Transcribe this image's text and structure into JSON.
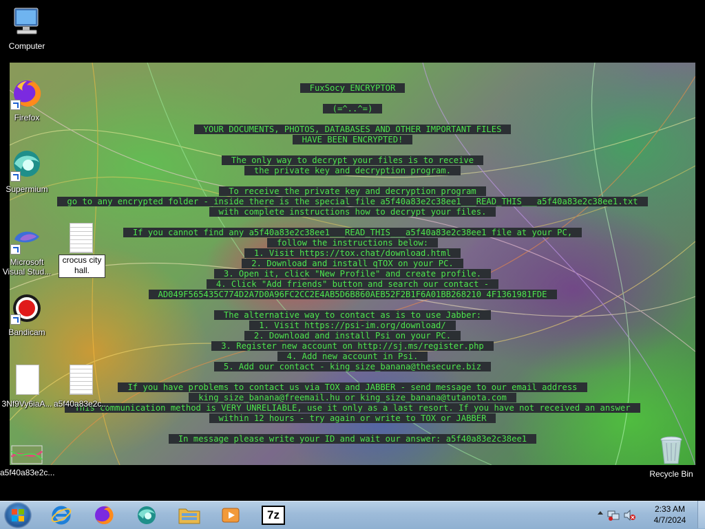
{
  "desktop_icons": {
    "computer": "Computer",
    "firefox": "Firefox",
    "supermium": "Supermium",
    "vs_line1": "Microsoft",
    "vs_line2": "Visual Stud...",
    "bandicam": "Bandicam",
    "file_3nf": "3Nf9Vy6iaA...",
    "file_a5f_txt": "a5f40a83e2c...",
    "file_a5f_img": "a5f40a83e2c...",
    "recycle_bin": "Recycle Bin",
    "rename_line1": "crocus city",
    "rename_line2": "hall."
  },
  "ransom_note": {
    "lines": [
      "FuxSocy ENCRYPTOR",
      "",
      "(=^..^=)",
      "",
      "YOUR DOCUMENTS, PHOTOS, DATABASES AND OTHER IMPORTANT FILES",
      "HAVE BEEN ENCRYPTED!",
      "",
      "The only way to decrypt your files is to receive",
      "the private key and decryption program.",
      "",
      "To receive the private key and decryption program",
      "go to any encrypted folder - inside there is the special file a5f40a83e2c38ee1___READ_THIS___a5f40a83e2c38ee1.txt",
      "with complete instructions how to decrypt your files.",
      "",
      "If you cannot find any a5f40a83e2c38ee1___READ_THIS___a5f40a83e2c38ee1 file at your PC,",
      "follow the instructions below:",
      "1. Visit https://tox.chat/download.html",
      "2. Download and install qTOX on your PC.",
      "3. Open it, click \"New Profile\" and create profile.",
      "4. Click \"Add friends\" button and search our contact -",
      "AD049F565435C774D2A7D0A96FC2CC2E4AB5D6B860AEB52F2B1F6A01BB268210 4F1361981FDE",
      "",
      "The alternative way to contact as is to use Jabber:",
      "1. Visit https://psi-im.org/download/",
      "2. Download and install Psi on your PC.",
      "3. Register new account on http://sj.ms/register.php",
      "4. Add new account in Psi.",
      "5. Add our contact - king_size_banana@thesecure.biz",
      "",
      "If you have problems to contact us via TOX and JABBER - send message to our email address",
      "king_size_banana@freemail.hu or king_size_banana@tutanota.com",
      "This communication method is VERY UNRELIABLE, use it only as a last resort. If you have not received an answer",
      "within 12 hours - try again or write to TOX or JABBER",
      "",
      "In message please write your ID and wait our answer: a5f40a83e2c38ee1"
    ]
  },
  "taskbar": {
    "apps": [
      "internet-explorer",
      "firefox",
      "supermium",
      "file-explorer",
      "media-player",
      "7-zip"
    ],
    "sevenzip_label": "7z"
  },
  "clock": {
    "time": "2:33 AM",
    "date": "4/7/2024"
  }
}
